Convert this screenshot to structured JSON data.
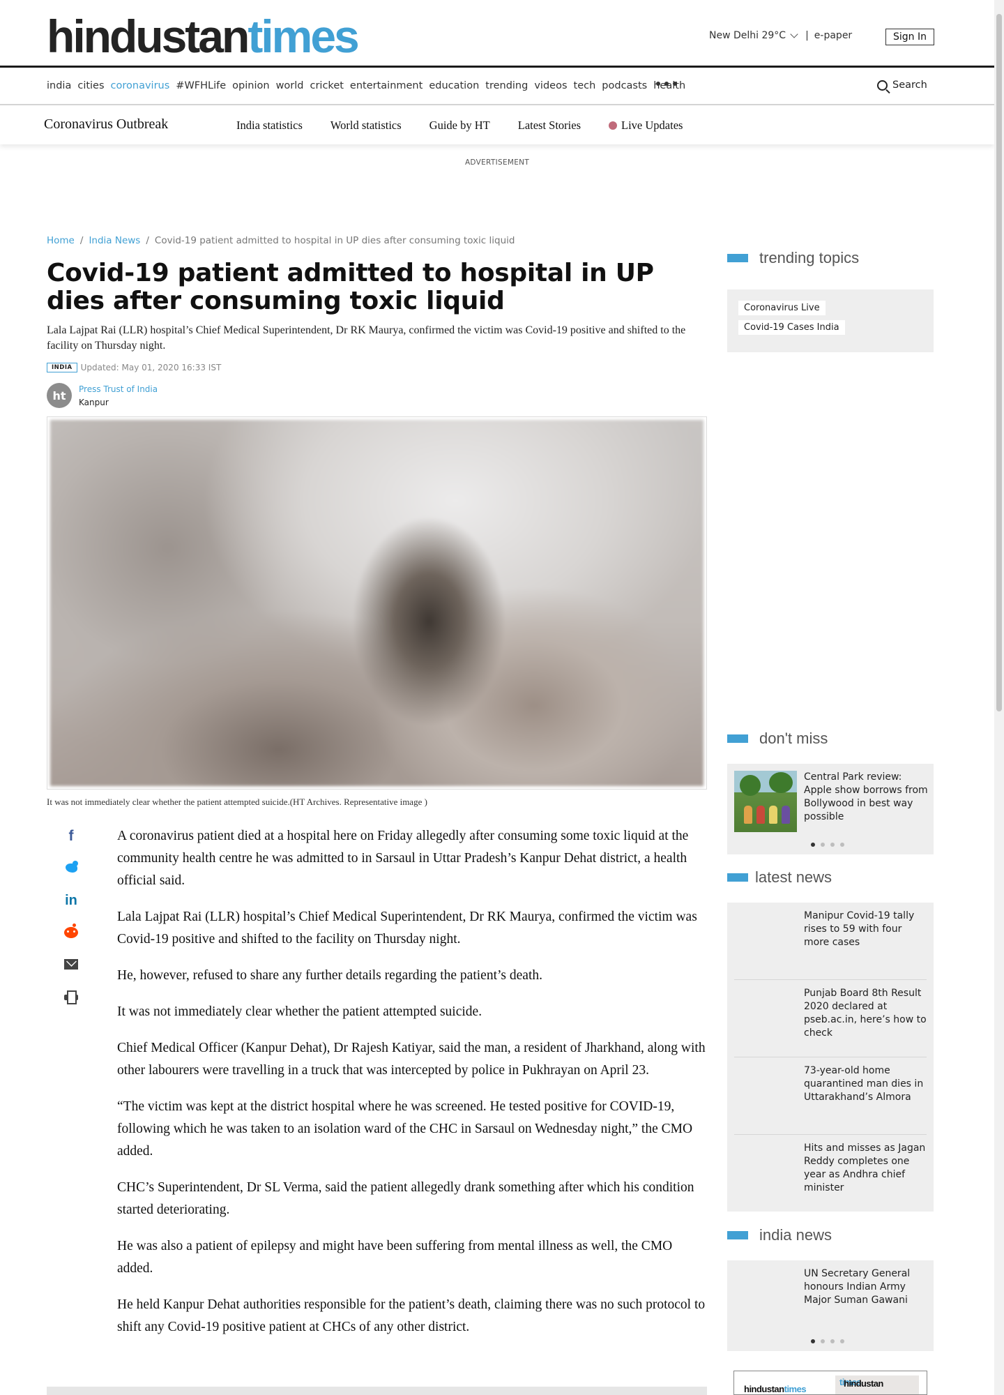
{
  "header": {
    "logo_part1": "hindustan",
    "logo_part2": "times",
    "weather": "New Delhi 29°C",
    "epaper": "e-paper",
    "signin": "Sign In",
    "search": "Search"
  },
  "nav": {
    "items": [
      "india",
      "cities",
      "coronavirus",
      "#WFHLife",
      "opinion",
      "world",
      "cricket",
      "entertainment",
      "education",
      "trending",
      "videos",
      "tech",
      "podcasts",
      "health"
    ],
    "active": "coronavirus"
  },
  "subnav": {
    "brand": "Coronavirus Outbreak",
    "links": [
      "India statistics",
      "World statistics",
      "Guide by HT",
      "Latest Stories"
    ],
    "live": "Live Updates"
  },
  "advertisement": "ADVERTISEMENT",
  "breadcrumb": {
    "home": "Home",
    "section": "India News",
    "current": "Covid-19 patient admitted to hospital in UP dies after consuming toxic liquid"
  },
  "article": {
    "headline": "Covid-19 patient admitted to hospital in UP dies after consuming toxic liquid",
    "summary": "Lala Lajpat Rai (LLR) hospital’s Chief Medical Superintendent, Dr RK Maurya, confirmed the victim was Covid-19 positive and shifted to the facility on Thursday night.",
    "tag": "INDIA",
    "updated": "Updated: May 01, 2020 16:33 IST",
    "author_initials": "ht",
    "author": "Press Trust of India",
    "location": "Kanpur",
    "caption": "It was not immediately clear whether the patient attempted suicide.(HT Archives. Representative image )",
    "paragraphs": [
      "A coronavirus patient died at a hospital here on Friday allegedly after consuming some toxic liquid at the community health centre he was admitted to in Sarsaul in Uttar Pradesh’s Kanpur Dehat district, a health official said.",
      "Lala Lajpat Rai (LLR) hospital’s Chief Medical Superintendent, Dr RK Maurya, confirmed the victim was Covid-19 positive and shifted to the facility on Thursday night.",
      "He, however, refused to share any further details regarding the patient’s death.",
      "It was not immediately clear whether the patient attempted suicide.",
      "Chief Medical Officer (Kanpur Dehat), Dr Rajesh Katiyar, said the man, a resident of Jharkhand, along with other labourers were travelling in a truck that was intercepted by police in Pukhrayan on April 23.",
      "“The victim was kept at the district hospital where he was screened. He tested positive for COVID-19, following which he was taken to an isolation ward of the CHC in Sarsaul on Wednesday night,” the CMO added.",
      "CHC’s Superintendent, Dr SL Verma, said the patient allegedly drank something after which his condition started deteriorating.",
      "He was also a patient of epilepsy and might have been suffering from mental illness as well, the CMO added.",
      "He held Kanpur Dehat authorities responsible for the patient’s death, claiming there was no such protocol to shift any Covid-19 positive patient at CHCs of any other district."
    ]
  },
  "share_icons": [
    "facebook-icon",
    "twitter-icon",
    "linkedin-icon",
    "reddit-icon",
    "email-icon",
    "print-icon"
  ],
  "sidebar": {
    "trending_title": "trending topics",
    "trending": [
      "Coronavirus Live",
      "Covid-19 Cases India"
    ],
    "dont_miss_title": "don't miss",
    "dont_miss_story": "Central Park review: Apple show borrows from Bollywood in best way possible",
    "latest_title": "latest news",
    "latest": [
      "Manipur Covid-19 tally rises to 59 with four more cases",
      "Punjab Board 8th Result 2020 declared at pseb.ac.in, here’s how to check",
      "73-year-old home quarantined man dies in Uttarakhand’s Almora",
      "Hits and misses as Jagan Reddy completes one year as Andhra chief minister"
    ],
    "india_title": "india news",
    "india_story": "UN Secretary General honours Indian Army Major Suman Gawani",
    "promo_1_a": "hindustan",
    "promo_1_b": "times",
    "promo_2_a": "hindustan",
    "promo_2_b": "times"
  },
  "colors": {
    "accent": "#41a0d4",
    "live_dot": "#c06a7a",
    "text": "#1a1a1a"
  }
}
